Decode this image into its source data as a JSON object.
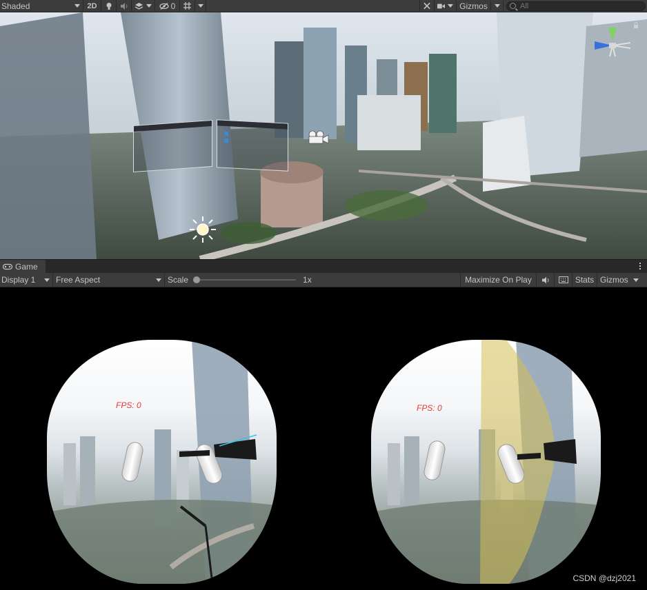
{
  "scene_toolbar": {
    "shading_mode": "Shaded",
    "mode_2d": "2D",
    "hidden_count": "0",
    "gizmos": "Gizmos",
    "search_placeholder": "All"
  },
  "scene_view": {
    "icons": [
      "sun-light-icon",
      "camera-gizmo-icon",
      "scene-orientation-gizmo"
    ]
  },
  "game_panel": {
    "tab_label": "Game",
    "display": "Display 1",
    "aspect": "Free Aspect",
    "scale_label": "Scale",
    "scale_value": "1x",
    "scale_fraction": 0.0,
    "maximize_on_play": "Maximize On Play",
    "stats": "Stats",
    "gizmos": "Gizmos"
  },
  "game_view": {
    "left_eye_fps": "FPS: 0",
    "right_eye_fps": "FPS: 0",
    "watermark": "CSDN @dzj2021"
  }
}
